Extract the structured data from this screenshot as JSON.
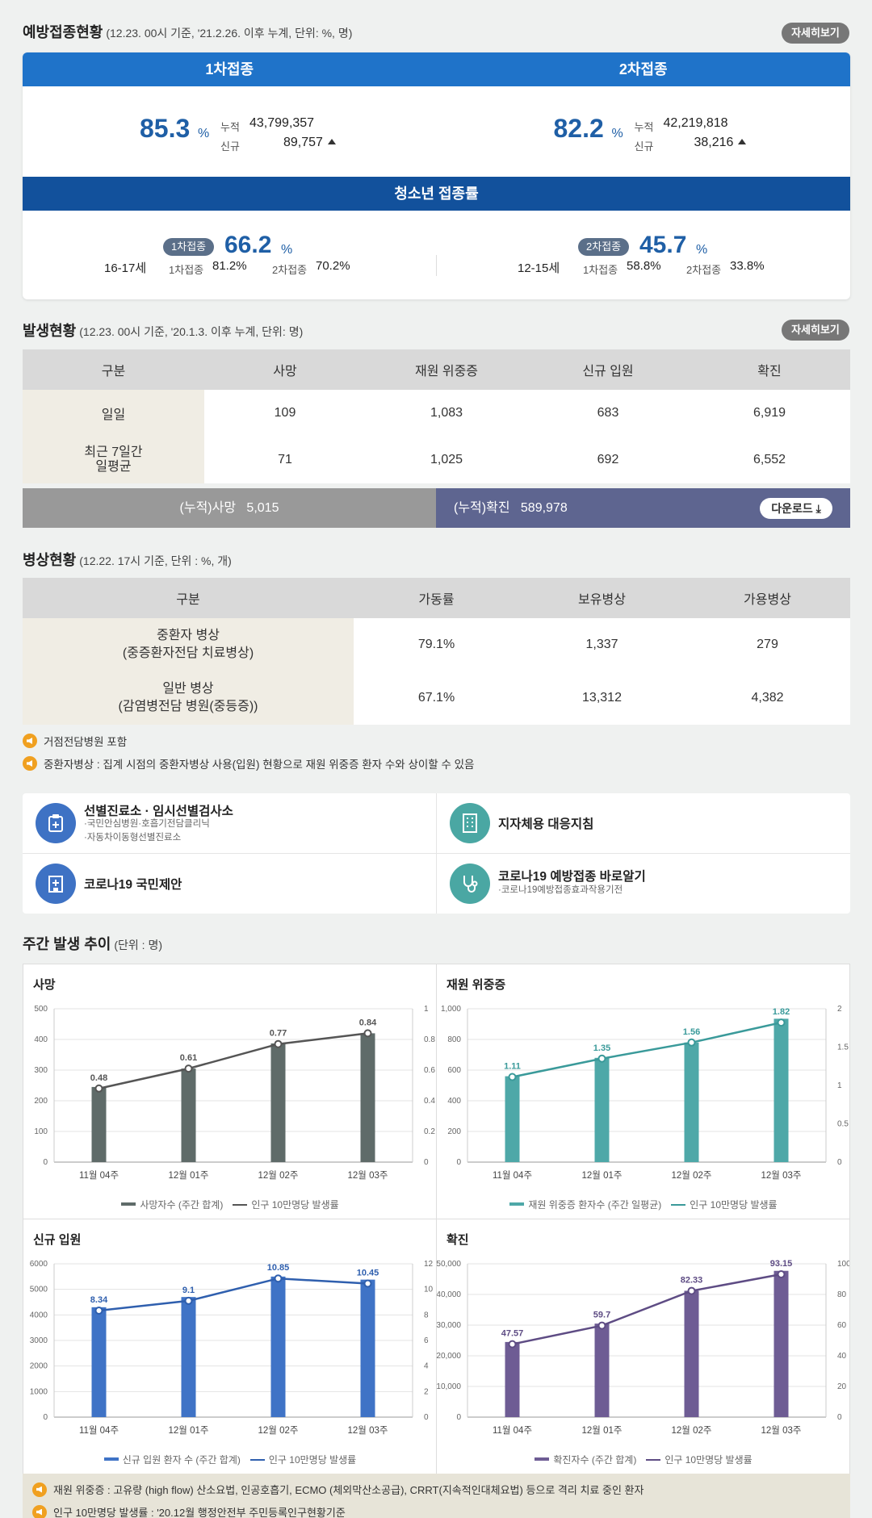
{
  "vaccination": {
    "title": "예방접종현황",
    "subtitle": "(12.23. 00시 기준, '21.2.26. 이후 누계, 단위: %, 명)",
    "detail_label": "자세히보기",
    "dose1": {
      "label": "1차접종",
      "rate": "85.3",
      "pct": "%",
      "cum_label": "누적",
      "cum": "43,799,357",
      "new_label": "신규",
      "new": "89,757"
    },
    "dose2": {
      "label": "2차접종",
      "rate": "82.2",
      "pct": "%",
      "cum_label": "누적",
      "cum": "42,219,818",
      "new_label": "신규",
      "new": "38,216"
    },
    "teen": {
      "title": "청소년 접종률",
      "group1": {
        "badge": "1차접종",
        "rate": "66.2",
        "pct": "%",
        "age": "16-17세",
        "l1": "1차접종",
        "v1": "81.2%",
        "l2": "2차접종",
        "v2": "70.2%"
      },
      "group2": {
        "badge": "2차접종",
        "rate": "45.7",
        "pct": "%",
        "age": "12-15세",
        "l1": "1차접종",
        "v1": "58.8%",
        "l2": "2차접종",
        "v2": "33.8%"
      }
    }
  },
  "occurrence": {
    "title": "발생현황",
    "subtitle": "(12.23. 00시 기준, '20.1.3. 이후 누계, 단위: 명)",
    "detail_label": "자세히보기",
    "headers": [
      "구분",
      "사망",
      "재원 위중증",
      "신규 입원",
      "확진"
    ],
    "rows": [
      {
        "label": "일일",
        "values": [
          "109",
          "1,083",
          "683",
          "6,919"
        ]
      },
      {
        "label": "최근 7일간 일평균",
        "values": [
          "71",
          "1,025",
          "692",
          "6,552"
        ]
      }
    ],
    "cum_death_label": "(누적)사망",
    "cum_death": "5,015",
    "cum_confirm_label": "(누적)확진",
    "cum_confirm": "589,978",
    "download_label": "다운로드"
  },
  "beds": {
    "title": "병상현황",
    "subtitle": "(12.22. 17시 기준, 단위 : %, 개)",
    "headers": [
      "구분",
      "가동률",
      "보유병상",
      "가용병상"
    ],
    "rows": [
      {
        "label1": "중환자 병상",
        "label2": "(중증환자전담 치료병상)",
        "values": [
          "79.1%",
          "1,337",
          "279"
        ]
      },
      {
        "label1": "일반 병상",
        "label2": "(감염병전담 병원(중등증))",
        "values": [
          "67.1%",
          "13,312",
          "4,382"
        ]
      }
    ],
    "notes": [
      "거점전담병원 포함",
      "중환자병상 : 집계 시점의 중환자병상 사용(입원) 현황으로 재원 위중증 환자 수와 상이할 수 있음"
    ]
  },
  "links": [
    {
      "title": "선별진료소 · 임시선별검사소",
      "sub1": "·국민안심병원·호흡기전담클리닉",
      "sub2": "·자동차이동형선별진료소"
    },
    {
      "title": "지자체용 대응지침"
    },
    {
      "title": "코로나19 국민제안"
    },
    {
      "title": "코로나19 예방접종 바로알기",
      "sub1": "·코로나19예방접종효과작용기전"
    }
  ],
  "weekly": {
    "title": "주간 발생 추이",
    "subtitle": "(단위 : 명)",
    "footnotes": [
      "재원 위중증 : 고유량 (high flow) 산소요법, 인공호흡기, ECMO (체외막산소공급), CRRT(지속적인대체요법) 등으로 격리 치료 중인 환자",
      "인구 10만명당 발생률 : '20.12월 행정안전부 주민등록인구현황기준"
    ]
  },
  "chart_data": [
    {
      "type": "bar",
      "title": "사망",
      "categories": [
        "11월 04주",
        "12월 01주",
        "12월 02주",
        "12월 03주"
      ],
      "series": [
        {
          "name": "사망자수 (주간 합계)",
          "values": [
            245,
            305,
            387,
            420
          ],
          "axis": "left"
        },
        {
          "name": "인구 10만명당 발생률",
          "type": "line",
          "values": [
            0.48,
            0.61,
            0.77,
            0.84
          ],
          "axis": "right"
        }
      ],
      "ylim": [
        0,
        500
      ],
      "y2lim": [
        0,
        1
      ],
      "yticks": [
        "0",
        "100",
        "200",
        "300",
        "400",
        "500"
      ],
      "y2ticks": [
        "0",
        "0.2",
        "0.4",
        "0.6",
        "0.8",
        "1"
      ],
      "bar_color": "#5f6b69",
      "line_color": "#555555"
    },
    {
      "type": "bar",
      "title": "재원 위중증",
      "categories": [
        "11월 04주",
        "12월 01주",
        "12월 02주",
        "12월 03주"
      ],
      "series": [
        {
          "name": "재원 위중증 환자수 (주간 일평균)",
          "values": [
            560,
            680,
            780,
            935
          ],
          "axis": "left"
        },
        {
          "name": "인구 10만명당 발생률",
          "type": "line",
          "values": [
            1.11,
            1.35,
            1.56,
            1.82
          ],
          "axis": "right"
        }
      ],
      "ylim": [
        0,
        1000
      ],
      "y2lim": [
        0,
        2
      ],
      "yticks": [
        "0",
        "200",
        "400",
        "600",
        "800",
        "1,000"
      ],
      "y2ticks": [
        "0",
        "0.5",
        "1",
        "1.5",
        "2"
      ],
      "bar_color": "#4ea8a8",
      "line_color": "#3a9a9a"
    },
    {
      "type": "bar",
      "title": "신규 입원",
      "categories": [
        "11월 04주",
        "12월 01주",
        "12월 02주",
        "12월 03주"
      ],
      "series": [
        {
          "name": "신규 입원 환자 수 (주간 합계)",
          "values": [
            4300,
            4700,
            5500,
            5380
          ],
          "axis": "left"
        },
        {
          "name": "인구 10만명당 발생률",
          "type": "line",
          "values": [
            8.34,
            9.1,
            10.85,
            10.45
          ],
          "axis": "right"
        }
      ],
      "ylim": [
        0,
        6000
      ],
      "y2lim": [
        0,
        12
      ],
      "yticks": [
        "0",
        "1000",
        "2000",
        "3000",
        "4000",
        "5000",
        "6000"
      ],
      "y2ticks": [
        "0",
        "2",
        "4",
        "6",
        "8",
        "10",
        "12"
      ],
      "bar_color": "#3f73c6",
      "line_color": "#2f5fae"
    },
    {
      "type": "bar",
      "title": "확진",
      "categories": [
        "11월 04주",
        "12월 01주",
        "12월 02주",
        "12월 03주"
      ],
      "series": [
        {
          "name": "확진자수 (주간 합계)",
          "values": [
            24500,
            30500,
            41200,
            47700
          ],
          "axis": "left"
        },
        {
          "name": "인구 10만명당 발생률",
          "type": "line",
          "values": [
            47.57,
            59.7,
            82.33,
            93.15
          ],
          "axis": "right"
        }
      ],
      "ylim": [
        0,
        50000
      ],
      "y2lim": [
        0,
        100
      ],
      "yticks": [
        "0",
        "10,000",
        "20,000",
        "30,000",
        "40,000",
        "50,000"
      ],
      "y2ticks": [
        "0",
        "20",
        "40",
        "60",
        "80",
        "100"
      ],
      "bar_color": "#6e5c94",
      "line_color": "#5e4c84"
    }
  ]
}
